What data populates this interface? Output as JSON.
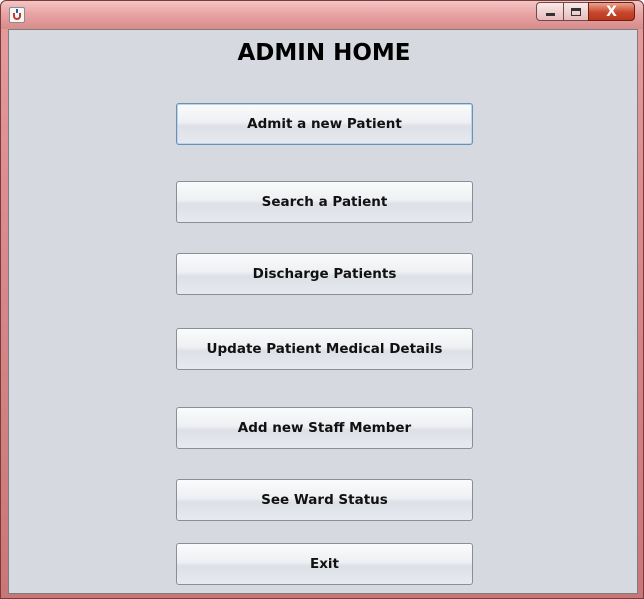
{
  "window": {
    "buttons": {
      "minimize_icon": "minimize-icon",
      "maximize_icon": "maximize-icon",
      "close_glyph": "X"
    }
  },
  "main": {
    "title": "ADMIN HOME",
    "buttons": [
      {
        "label": "Admit a new Patient"
      },
      {
        "label": "Search a Patient"
      },
      {
        "label": "Discharge Patients"
      },
      {
        "label": "Update Patient Medical Details"
      },
      {
        "label": "Add new Staff Member"
      },
      {
        "label": "See Ward Status"
      },
      {
        "label": "Exit"
      }
    ]
  },
  "colors": {
    "titlebar": "#e8a4a4",
    "panel_background": "#d6d9df",
    "close_button": "#c9472c",
    "focus_border": "#6b8fb6"
  }
}
